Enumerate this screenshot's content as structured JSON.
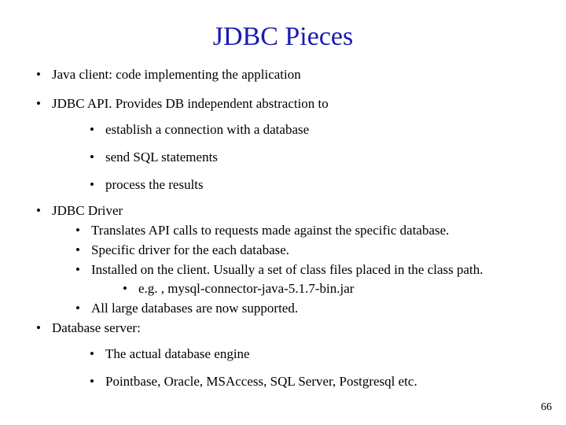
{
  "title": "JDBC Pieces",
  "page_number": "66",
  "items": {
    "l1_0": "Java client: code implementing the application",
    "l1_1": "JDBC API. Provides DB independent abstraction to",
    "l1_1_sub": {
      "s0": "establish a connection with a database",
      "s1": "send SQL statements",
      "s2": "process the results"
    },
    "l1_2": "JDBC Driver",
    "l1_2_sub": {
      "s0": "Translates API calls to requests made against the specific database.",
      "s1": "Specific driver for the each database.",
      "s2": "Installed on the client. Usually a set of class files placed in the class path.",
      "s2_sub": {
        "t0": "e.g. , mysql-connector-java-5.1.7-bin.jar"
      },
      "s3": "All large databases are now supported."
    },
    "l1_3": "Database server:",
    "l1_3_sub": {
      "s0": "The actual database engine",
      "s1": "Pointbase, Oracle, MSAccess, SQL Server, Postgresql etc."
    }
  }
}
